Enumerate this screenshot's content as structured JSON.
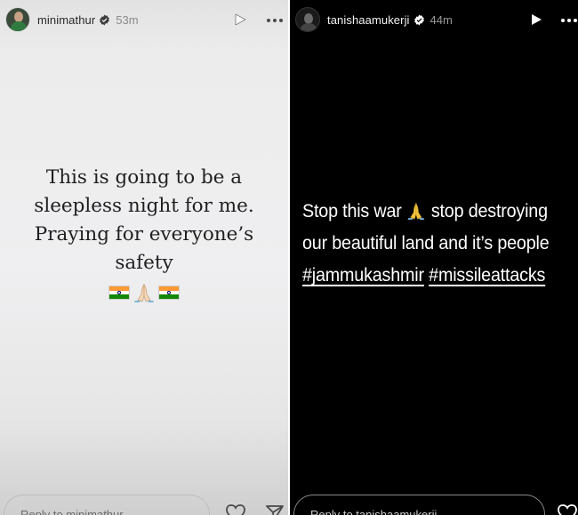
{
  "stories": [
    {
      "username": "minimathur",
      "time": "53m",
      "text_lines": [
        "This is going to be a",
        "sleepless night for me.",
        "Praying for everyone’s",
        "safety"
      ],
      "emojis": [
        "india-flag",
        "folded-hands",
        "india-flag"
      ],
      "reply_placeholder": "Reply to minimathur...",
      "background": "#ececec",
      "text_color": "#1f1f1f"
    },
    {
      "username": "tanishaamukerji",
      "time": "44m",
      "line1_before": "Stop this war",
      "line1_after": "stop destroying",
      "line2": "our beautiful land and it’s people",
      "hashtags": [
        "#jammukashmir",
        "#missileattacks"
      ],
      "reply_placeholder": "Reply to tanishaamukerji...",
      "background": "#000000",
      "text_color": "#ffffff"
    }
  ],
  "icons": [
    "verified-icon",
    "play-icon",
    "more-icon",
    "folded-hands-icon",
    "india-flag-icon",
    "heart-icon",
    "send-icon"
  ]
}
